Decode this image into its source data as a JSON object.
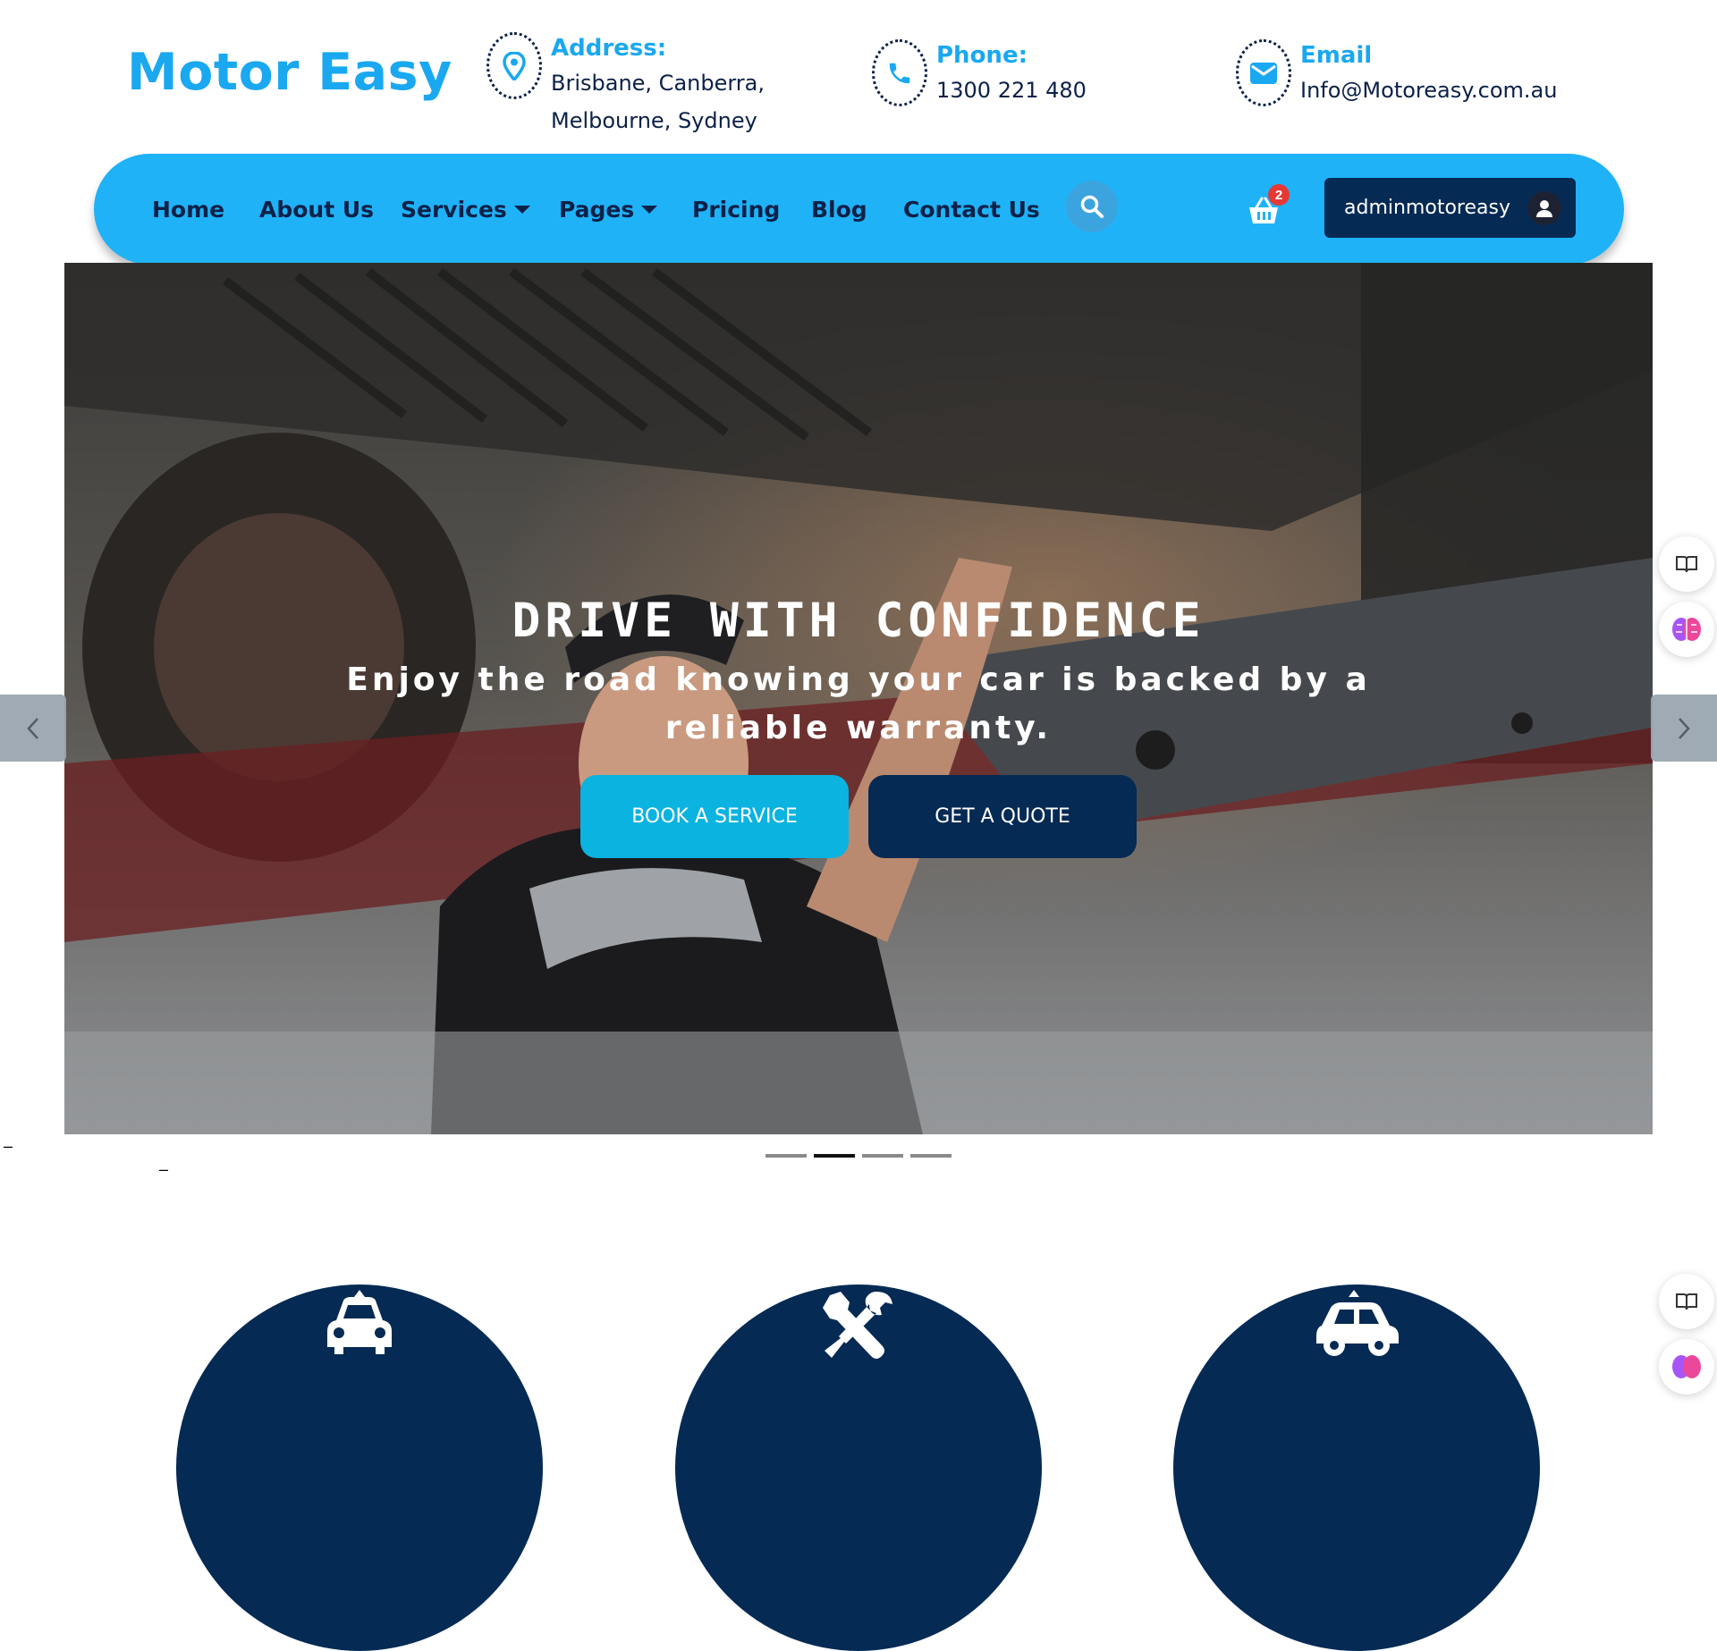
{
  "brand": {
    "name": "Motor Easy"
  },
  "contact": {
    "address": {
      "label": "Address:",
      "line1": "Brisbane, Canberra,",
      "line2": "Melbourne, Sydney",
      "icon": "map-pin-icon"
    },
    "phone": {
      "label": "Phone:",
      "value": "1300 221 480",
      "icon": "phone-icon"
    },
    "email": {
      "label": "Email",
      "value": "Info@Motoreasy.com.au",
      "icon": "envelope-icon"
    }
  },
  "nav": {
    "items": [
      {
        "label": "Home"
      },
      {
        "label": "About Us"
      },
      {
        "label": "Services",
        "dropdown": true
      },
      {
        "label": "Pages",
        "dropdown": true
      },
      {
        "label": "Pricing"
      },
      {
        "label": "Blog"
      },
      {
        "label": "Contact Us"
      }
    ],
    "cart_count": "2",
    "username": "adminmotoreasy"
  },
  "hero": {
    "title": "DRIVE WITH CONFIDENCE",
    "subtitle": "Enjoy the road knowing your car is backed by a reliable warranty.",
    "buttons": {
      "book": "BOOK A SERVICE",
      "quote": "GET A QUOTE"
    },
    "slides_total": 4,
    "active_slide": 2
  },
  "features": [
    {
      "icon": "car-icon"
    },
    {
      "icon": "wrench-screwdriver-icon"
    },
    {
      "icon": "car-side-icon"
    }
  ],
  "colors": {
    "accent": "#1fb2f7",
    "navy": "#052a54",
    "book_button": "#0ab3e0",
    "badge": "#e53935"
  }
}
